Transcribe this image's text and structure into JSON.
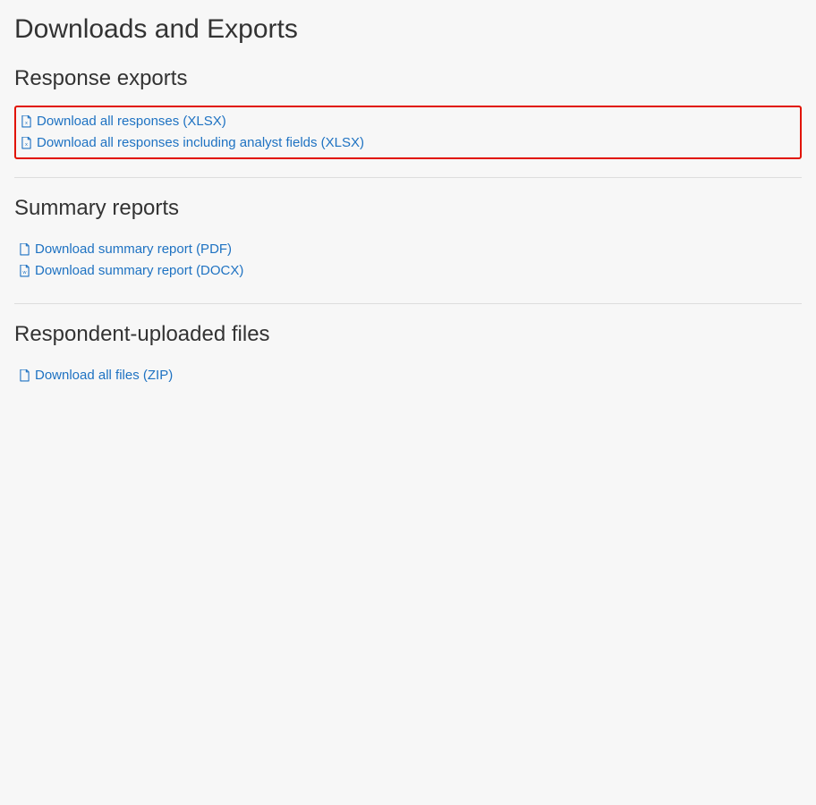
{
  "page": {
    "title": "Downloads and Exports"
  },
  "sections": {
    "responseExports": {
      "heading": "Response exports",
      "links": [
        {
          "label": "Download all responses (XLSX)",
          "iconLetter": "x"
        },
        {
          "label": "Download all responses including analyst fields (XLSX)",
          "iconLetter": "x"
        }
      ]
    },
    "summaryReports": {
      "heading": "Summary reports",
      "links": [
        {
          "label": "Download summary report (PDF)",
          "iconLetter": ""
        },
        {
          "label": "Download summary report (DOCX)",
          "iconLetter": "w"
        }
      ]
    },
    "respondentFiles": {
      "heading": "Respondent-uploaded files",
      "links": [
        {
          "label": "Download all files (ZIP)",
          "iconLetter": ""
        }
      ]
    }
  }
}
